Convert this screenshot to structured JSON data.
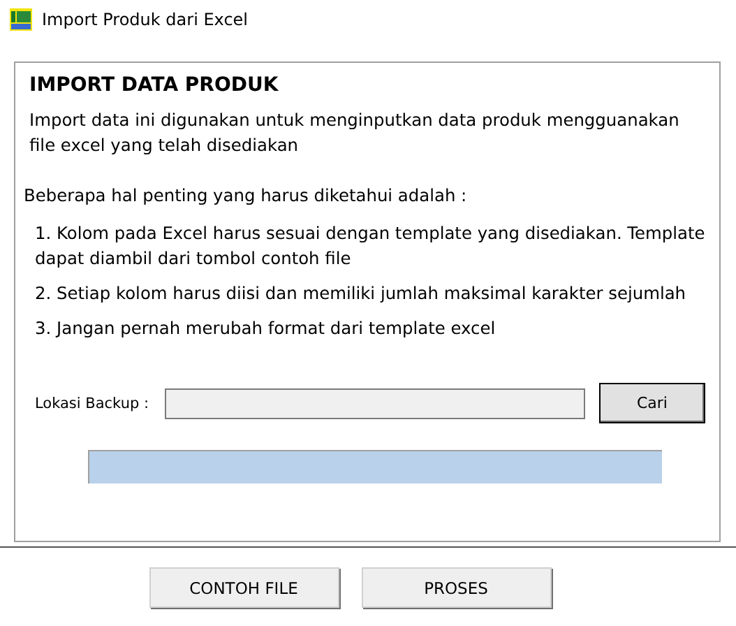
{
  "window": {
    "title": "Import Produk dari Excel"
  },
  "panel": {
    "heading": "IMPORT DATA PRODUK",
    "intro": "Import data ini digunakan untuk menginputkan data produk mengguanakan file excel yang telah disediakan",
    "notes_heading": "Beberapa hal penting yang harus diketahui adalah :",
    "notes": [
      "1. Kolom pada Excel harus sesuai dengan template yang disediakan. Template dapat diambil dari tombol contoh file",
      "2. Setiap kolom harus diisi dan memiliki jumlah maksimal karakter sejumlah",
      "3. Jangan pernah merubah format dari template excel"
    ],
    "backup": {
      "label": "Lokasi Backup :",
      "button": "Cari"
    }
  },
  "buttons": [
    "CONTOH FILE",
    "PROSES"
  ]
}
